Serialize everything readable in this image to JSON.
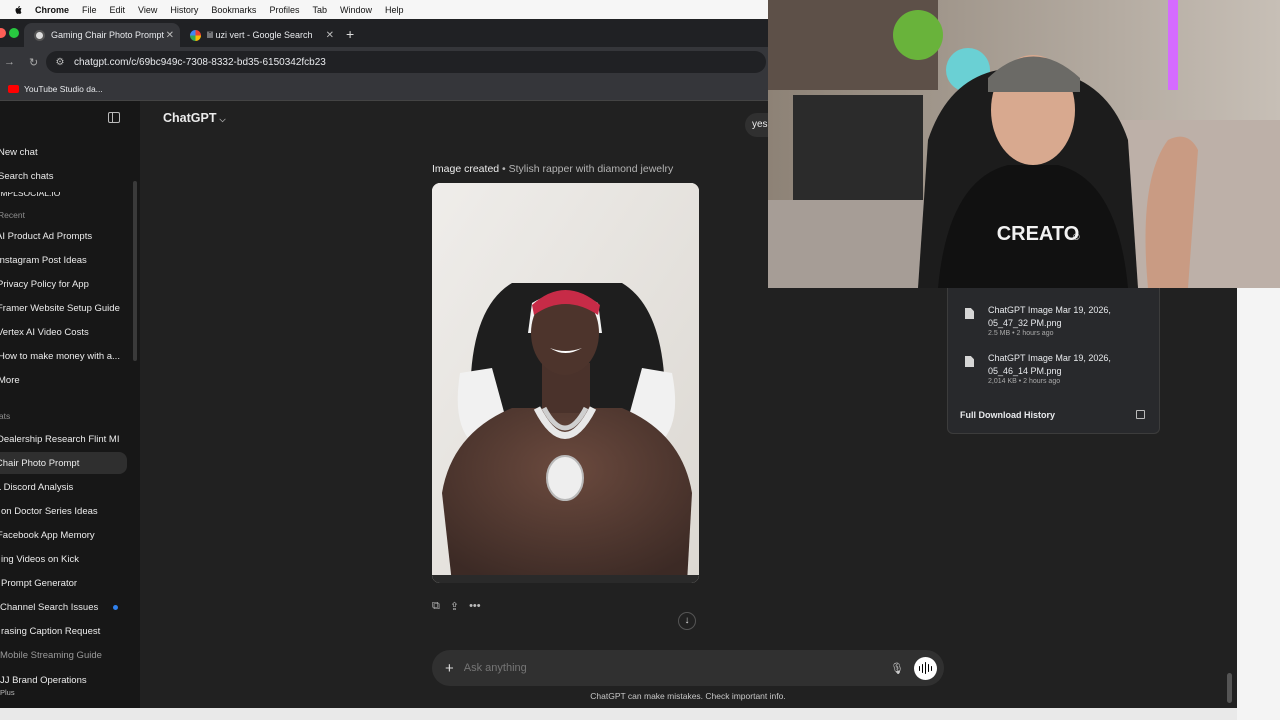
{
  "menubar": {
    "app": "Chrome",
    "items": [
      "File",
      "Edit",
      "View",
      "History",
      "Bookmarks",
      "Profiles",
      "Tab",
      "Window",
      "Help"
    ]
  },
  "browser": {
    "tabs": [
      {
        "title": "Gaming Chair Photo Prompt",
        "favicon": "openai-icon",
        "active": true
      },
      {
        "title": "lil uzi vert - Google Search",
        "favicon": "google-icon",
        "active": false
      }
    ],
    "url": "chatgpt.com/c/69bc949c-7308-8332-bd35-6150342fcb23",
    "bookmarks": [
      {
        "label": "YouTube Studio da...",
        "icon": "youtube-icon"
      }
    ]
  },
  "sidebar": {
    "new_chat": "New chat",
    "search_chats": "Search chats",
    "cut_item": "IMPLSOCIAL.IO",
    "recent_label": "Recent",
    "recent": [
      "AI Product Ad Prompts",
      "Instagram Post Ideas",
      "Privacy Policy for App",
      "Framer Website Setup Guide",
      "Vertex AI Video Costs",
      "How to make money with a..."
    ],
    "more": "More",
    "chats_label": "Chats",
    "chats": [
      "Dealership Research Flint MI",
      "Gaming Chair Photo Prompt",
      "L Discord Analysis",
      "on Doctor Series Ideas",
      "Facebook App Memory",
      "ing Videos on Kick",
      "Prompt Generator",
      "Channel Search Issues",
      "rasing Caption Request",
      "Mobile Streaming Guide"
    ],
    "account_name": "JJ Brand Operations",
    "account_plan": "Plus"
  },
  "main": {
    "model": "ChatGPT",
    "right_button": "yes",
    "caption_strong": "Image created",
    "caption_rest": " • Stylish rapper with diamond jewelry",
    "composer_placeholder": "Ask anything",
    "disclaimer": "ChatGPT can make mistakes. Check important info."
  },
  "downloads": {
    "items": [
      {
        "name": "ChatGPT Image Mar 19, 2026, 05_47_32 PM.png",
        "meta": "2.5 MB • 2 hours ago"
      },
      {
        "name": "ChatGPT Image Mar 19, 2026, 05_46_14 PM.png",
        "meta": "2,014 KB • 2 hours ago"
      }
    ],
    "history_label": "Full Download History"
  },
  "overlay": {
    "shirt_text": "CREATO",
    "shirt_mark": "®"
  }
}
